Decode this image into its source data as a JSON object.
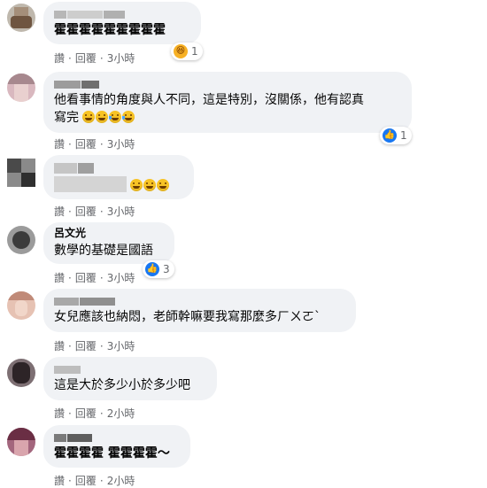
{
  "comments": [
    {
      "text": "霍霍霍霍霍霍霍霍霍",
      "reaction": {
        "icon": "haha-icon",
        "count": "1"
      }
    },
    {
      "text_line1": "他看事情的角度與人不同，這是特別，沒關係，他有認真",
      "text_line2": "寫完",
      "reaction": {
        "icon": "like-icon",
        "count": "1"
      }
    },
    {
      "text": ""
    },
    {
      "name": "呂文光",
      "text": "數學的基礎是國語",
      "reaction": {
        "icon": "like-icon",
        "count": "3"
      }
    },
    {
      "text": "女兒應該也納悶，老師幹嘛要我寫那麼多ㄏㄨㄛˋ"
    },
    {
      "text": "這是大於多少小於多少吧"
    },
    {
      "text": "霍霍霍霍 霍霍霍霍～"
    }
  ],
  "actions": {
    "like": "讚",
    "reply": "回覆",
    "sep": "·",
    "times": [
      "3小時",
      "3小時",
      "3小時",
      "3小時",
      "3小時",
      "2小時",
      "2小時"
    ]
  },
  "colors": {
    "bubble": "#f0f2f5",
    "meta": "#65676b",
    "like_blue": "#1877f2",
    "haha_yellow": "#f7b125"
  }
}
